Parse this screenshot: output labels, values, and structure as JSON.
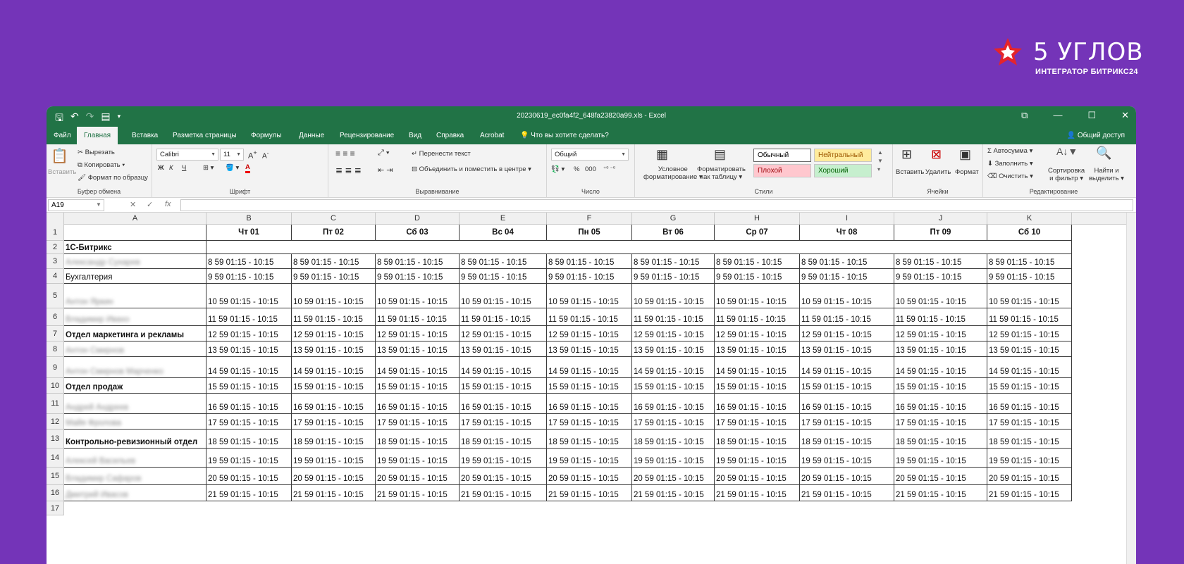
{
  "brand": {
    "name": "5 УГЛОВ",
    "tagline": "ИНТЕГРАТОР БИТРИКС24",
    "accent": "#e5242b"
  },
  "window": {
    "title": "20230619_ec0fa4f2_648fa23820a99.xls  -  Excel",
    "bg": "#217346"
  },
  "tabs": [
    "Файл",
    "Главная",
    "Вставка",
    "Разметка страницы",
    "Формулы",
    "Данные",
    "Рецензирование",
    "Вид",
    "Справка",
    "Acrobat",
    "Что вы хотите сделать?"
  ],
  "share_label": "Общий доступ",
  "ribbon": {
    "clipboard": {
      "paste": "Вставить",
      "cut": "Вырезать",
      "copy": "Копировать",
      "format_painter": "Формат по образцу",
      "label": "Буфер обмена"
    },
    "font": {
      "name": "Calibri",
      "size": "11",
      "bold": "Ж",
      "italic": "К",
      "underline": "Ч",
      "label": "Шрифт"
    },
    "alignment": {
      "wrap": "Перенести текст",
      "merge": "Объединить и поместить в центре",
      "label": "Выравнивание"
    },
    "number": {
      "format": "Общий",
      "percent": "%",
      "thousands": "000",
      "label": "Число"
    },
    "styles": {
      "conditional_1": "Условное",
      "conditional_2": "форматирование",
      "as_table_1": "Форматировать",
      "as_table_2": "как таблицу",
      "normal": "Обычный",
      "neutral": "Нейтральный",
      "bad": "Плохой",
      "good": "Хороший",
      "label": "Стили"
    },
    "cells": {
      "insert": "Вставить",
      "delete": "Удалить",
      "format": "Формат",
      "label": "Ячейки"
    },
    "editing": {
      "autosum": "Автосумма",
      "fill": "Заполнить",
      "clear": "Очистить",
      "sort_1": "Сортировка",
      "sort_2": "и фильтр",
      "find_1": "Найти и",
      "find_2": "выделить",
      "label": "Редактирование"
    }
  },
  "name_box": "A19",
  "columns": [
    "A",
    "B",
    "C",
    "D",
    "E",
    "F",
    "G",
    "H",
    "I",
    "J",
    "K"
  ],
  "row_numbers": [
    "1",
    "2",
    "3",
    "4",
    "5",
    "6",
    "7",
    "8",
    "9",
    "10",
    "11",
    "12",
    "13",
    "14",
    "15",
    "16",
    "17"
  ],
  "day_headers": [
    "Чт 01",
    "Пт 02",
    "Сб 03",
    "Вс 04",
    "Пн 05",
    "Вт 06",
    "Ср 07",
    "Чт 08",
    "Пт 09",
    "Сб 10"
  ],
  "row_labels": [
    {
      "text": "",
      "kind": "head"
    },
    {
      "text": "1С-Битрикс",
      "kind": "dept"
    },
    {
      "text": "Александр Сухарев",
      "kind": "blurred"
    },
    {
      "text": "Бухгалтерия",
      "kind": "normal"
    },
    {
      "text": "Антон Яркин",
      "kind": "blurred"
    },
    {
      "text": "Владимир Ивахо",
      "kind": "blurred"
    },
    {
      "text": "Отдел маркетинга и рекламы",
      "kind": "dept"
    },
    {
      "text": "Антон Смирнов",
      "kind": "blurred"
    },
    {
      "text": "Антон Смирнов Марченко",
      "kind": "blurred"
    },
    {
      "text": "Отдел продаж",
      "kind": "dept"
    },
    {
      "text": "Андрей Андреев",
      "kind": "blurred"
    },
    {
      "text": "Майя Фролова",
      "kind": "blurred"
    },
    {
      "text": "Контрольно-ревизионный отдел",
      "kind": "dept"
    },
    {
      "text": "Алексей Васильев",
      "kind": "blurred"
    },
    {
      "text": "Владимир Сафаров",
      "kind": "blurred"
    },
    {
      "text": "Дмитрий Ивасов",
      "kind": "blurred"
    }
  ],
  "row_values": [
    "8 59 01:15 - 10:15",
    "9 59 01:15 - 10:15",
    "10 59 01:15 - 10:15",
    "11 59 01:15 - 10:15",
    "12 59 01:15 - 10:15",
    "13 59 01:15 - 10:15",
    "14 59 01:15 - 10:15",
    "15 59 01:15 - 10:15",
    "16 59 01:15 - 10:15",
    "17 59 01:15 - 10:15",
    "18 59 01:15 - 10:15",
    "19 59 01:15 - 10:15",
    "20 59 01:15 - 10:15",
    "21 59 01:15 - 10:15"
  ]
}
